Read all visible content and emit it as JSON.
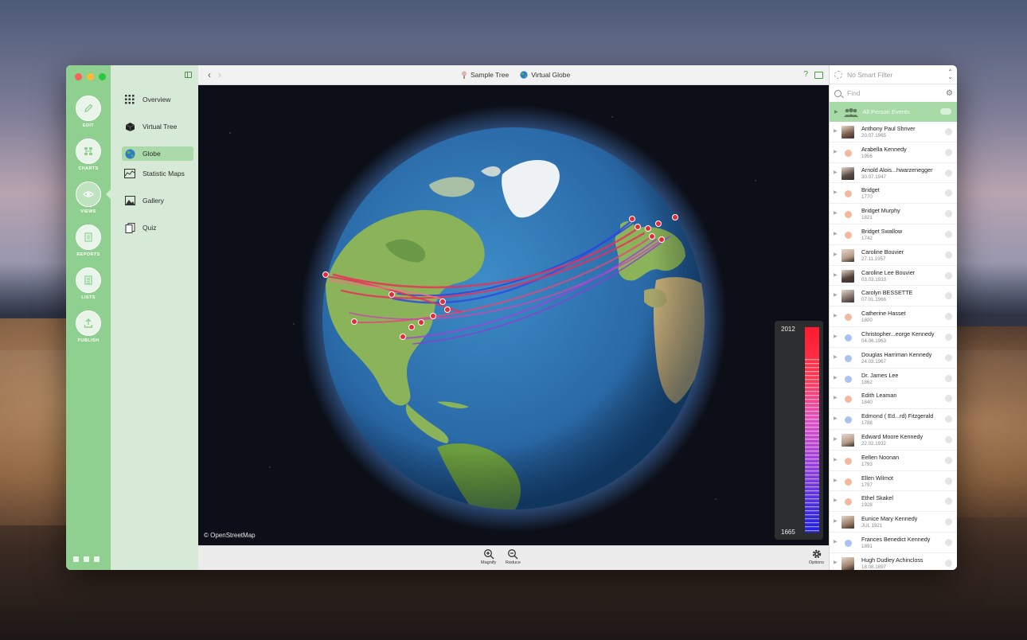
{
  "window": {
    "title_items": [
      {
        "label": "Sample Tree",
        "icon": "tree-icon"
      },
      {
        "label": "Virtual Globe",
        "icon": "globe-icon"
      }
    ],
    "help_label": "?"
  },
  "rail": {
    "items": [
      {
        "label": "EDIT",
        "icon": "pencil-icon"
      },
      {
        "label": "CHARTS",
        "icon": "charts-icon"
      },
      {
        "label": "VIEWS",
        "icon": "eye-icon"
      },
      {
        "label": "REPORTS",
        "icon": "reports-icon"
      },
      {
        "label": "LISTS",
        "icon": "lists-icon"
      },
      {
        "label": "PUBLISH",
        "icon": "publish-icon"
      }
    ]
  },
  "sidebar": {
    "items": [
      {
        "label": "Overview",
        "icon": "grid-icon"
      },
      {
        "label": "Virtual Tree",
        "icon": "cube-icon"
      },
      {
        "label": "Globe",
        "icon": "globe-icon",
        "active": true
      },
      {
        "label": "Statistic Maps",
        "icon": "map-chart-icon"
      },
      {
        "label": "Gallery",
        "icon": "image-icon"
      },
      {
        "label": "Quiz",
        "icon": "cards-icon"
      }
    ]
  },
  "map": {
    "attribution": "© OpenStreetMap",
    "timeline_max": "2012",
    "timeline_min": "1665",
    "colors": {
      "ocean": "#2f78b4",
      "land": "#8bb35a",
      "arc_red": "#e8315a",
      "arc_blue": "#3050e0",
      "arc_purple": "#a040e0"
    }
  },
  "bottom": {
    "magnify": "Magnify",
    "reduce": "Reduce",
    "options": "Options"
  },
  "right_panel": {
    "filter": "No Smart Filter",
    "search_placeholder": "Find",
    "all_events": "All Person Events",
    "persons": [
      {
        "name": "Anthony Paul Shriver",
        "date": "20.07.1965",
        "kind": "photo"
      },
      {
        "name": "Arabella Kennedy",
        "date": "1956",
        "kind": "female"
      },
      {
        "name": "Arnold Alois...hwarzenegger",
        "date": "30.07.1947",
        "kind": "photo"
      },
      {
        "name": "Bridget",
        "date": "1770",
        "kind": "female"
      },
      {
        "name": "Bridget Murphy",
        "date": "1821",
        "kind": "female"
      },
      {
        "name": "Bridget Swallow",
        "date": "1742",
        "kind": "female"
      },
      {
        "name": "Caroline Bouvier",
        "date": "27.11.1957",
        "kind": "photo"
      },
      {
        "name": "Caroline Lee Bouvier",
        "date": "03.03.1933",
        "kind": "photo"
      },
      {
        "name": "Carolyn BESSETTE",
        "date": "07.01.1966",
        "kind": "photo"
      },
      {
        "name": "Catherine Hasset",
        "date": "1800",
        "kind": "female"
      },
      {
        "name": "Christopher...eorge Kennedy",
        "date": "04.06.1963",
        "kind": "male"
      },
      {
        "name": "Douglas Harriman Kennedy",
        "date": "24.03.1967",
        "kind": "male"
      },
      {
        "name": "Dr. James Lee",
        "date": "1862",
        "kind": "male"
      },
      {
        "name": "Edith Leaman",
        "date": "1840",
        "kind": "female"
      },
      {
        "name": "Edmond ( Ed...rd) Fitzgerald",
        "date": "1788",
        "kind": "male"
      },
      {
        "name": "Edward Moore Kennedy",
        "date": "22.02.1932",
        "kind": "photo"
      },
      {
        "name": "Eellen Noonan",
        "date": "1793",
        "kind": "female"
      },
      {
        "name": "Ellen Wilmot",
        "date": "1797",
        "kind": "female"
      },
      {
        "name": "Ethel Skakel",
        "date": "1928",
        "kind": "female"
      },
      {
        "name": "Eunice Mary Kennedy",
        "date": "JUL 1921",
        "kind": "photo"
      },
      {
        "name": "Frances Benedict Kennedy",
        "date": "1891",
        "kind": "male"
      },
      {
        "name": "Hugh Dudley Achincloss",
        "date": "18.08.1897",
        "kind": "photo"
      }
    ]
  }
}
